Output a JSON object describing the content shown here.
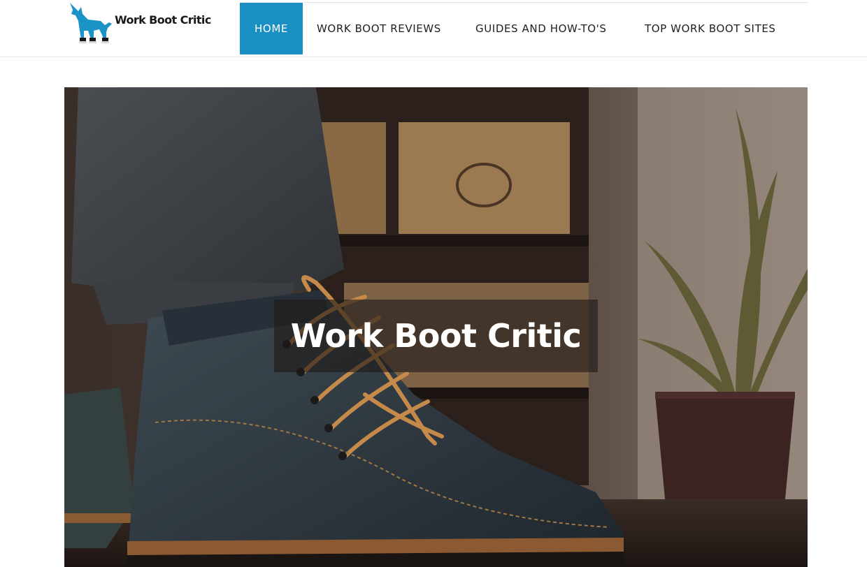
{
  "site": {
    "logo_text": "Work Boot Critic",
    "logo_icon": "dog-in-boots-icon"
  },
  "nav": {
    "items": [
      {
        "label": "HOME",
        "active": true
      },
      {
        "label": "WORK BOOT REVIEWS",
        "active": false
      },
      {
        "label": "GUIDES AND HOW-TO'S",
        "active": false
      },
      {
        "label": "TOP WORK BOOT SITES",
        "active": false
      }
    ]
  },
  "hero": {
    "title": "Work Boot Critic",
    "image": "work-boot-photo"
  },
  "colors": {
    "accent": "#1a8fc4",
    "logo_dog": "#1b93c6",
    "text_dark": "#1f1f1f"
  }
}
